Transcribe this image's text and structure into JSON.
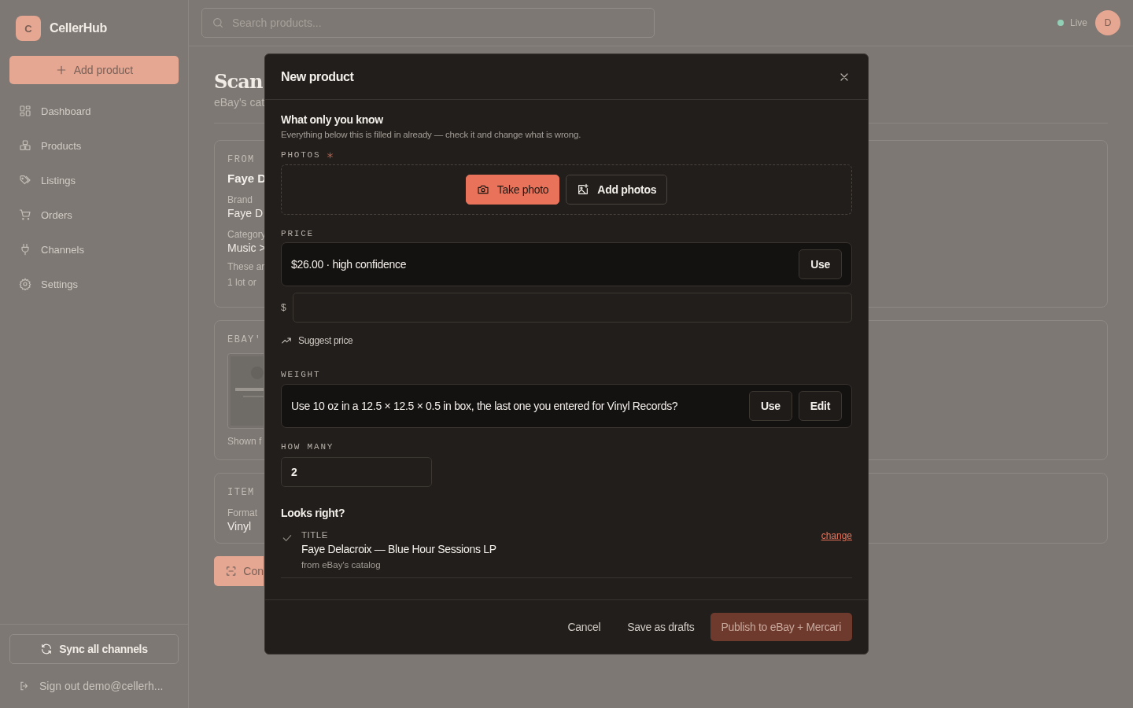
{
  "sidebar": {
    "logo": {
      "initial": "C",
      "name": "CellerHub"
    },
    "add_button": "Add product",
    "nav": [
      {
        "label": "Dashboard"
      },
      {
        "label": "Products"
      },
      {
        "label": "Listings"
      },
      {
        "label": "Orders"
      },
      {
        "label": "Channels"
      },
      {
        "label": "Settings"
      }
    ],
    "sync_button": "Sync all channels",
    "sign_out": "Sign out demo@cellerh..."
  },
  "topbar": {
    "search": {
      "placeholder": "Search products..."
    },
    "status": "Live",
    "avatar": "D"
  },
  "page": {
    "title": "Scan",
    "subtitle": "eBay's cat",
    "cards": [
      {
        "kind": "details",
        "label": "FROM",
        "title": "Faye D",
        "fields": [
          {
            "label": "Brand",
            "value": "Faye D"
          },
          {
            "label": "Category",
            "value": "Music >"
          }
        ],
        "notes": [
          "These ar",
          "1 lot or"
        ]
      },
      {
        "kind": "picture",
        "label": "EBAY'",
        "notes": [
          "Shown f"
        ]
      },
      {
        "kind": "details",
        "label": "ITEM",
        "fields": [
          {
            "label": "Format",
            "value": "Vinyl"
          }
        ]
      }
    ],
    "action_button": "Con"
  },
  "modal": {
    "title": "New product",
    "heading": "What only you know",
    "intro": "Everything below this is filled in already — check it and change what is wrong.",
    "photos": {
      "label": "PHOTOS",
      "required": true,
      "buttons": [
        {
          "label": "Take photo",
          "kind": "primary"
        },
        {
          "label": "Add photos",
          "kind": "secondary"
        }
      ]
    },
    "price": {
      "label": "PRICE",
      "suggestion": "$26.00 · high confidence",
      "use_button": "Use",
      "currency": "$",
      "suggest_link": "Suggest price"
    },
    "weight": {
      "label": "WEIGHT",
      "suggestion": "Use 10 oz in a 12.5 × 12.5 × 0.5 in box, the last one you entered for Vinyl Records?",
      "buttons": [
        "Use",
        "Edit"
      ]
    },
    "quantity": {
      "label": "HOW MANY",
      "value": "2"
    },
    "review": {
      "heading": "Looks right?",
      "items": [
        {
          "label": "TITLE",
          "value": "Faye Delacroix — Blue Hour Sessions LP",
          "source": "from eBay's catalog",
          "action": "change",
          "checked": true
        }
      ]
    },
    "footer": [
      {
        "label": "Cancel",
        "kind": "ghost"
      },
      {
        "label": "Save as drafts",
        "kind": "ghost"
      },
      {
        "label": "Publish to eBay + Mercari",
        "kind": "primary",
        "disabled": true
      }
    ]
  }
}
